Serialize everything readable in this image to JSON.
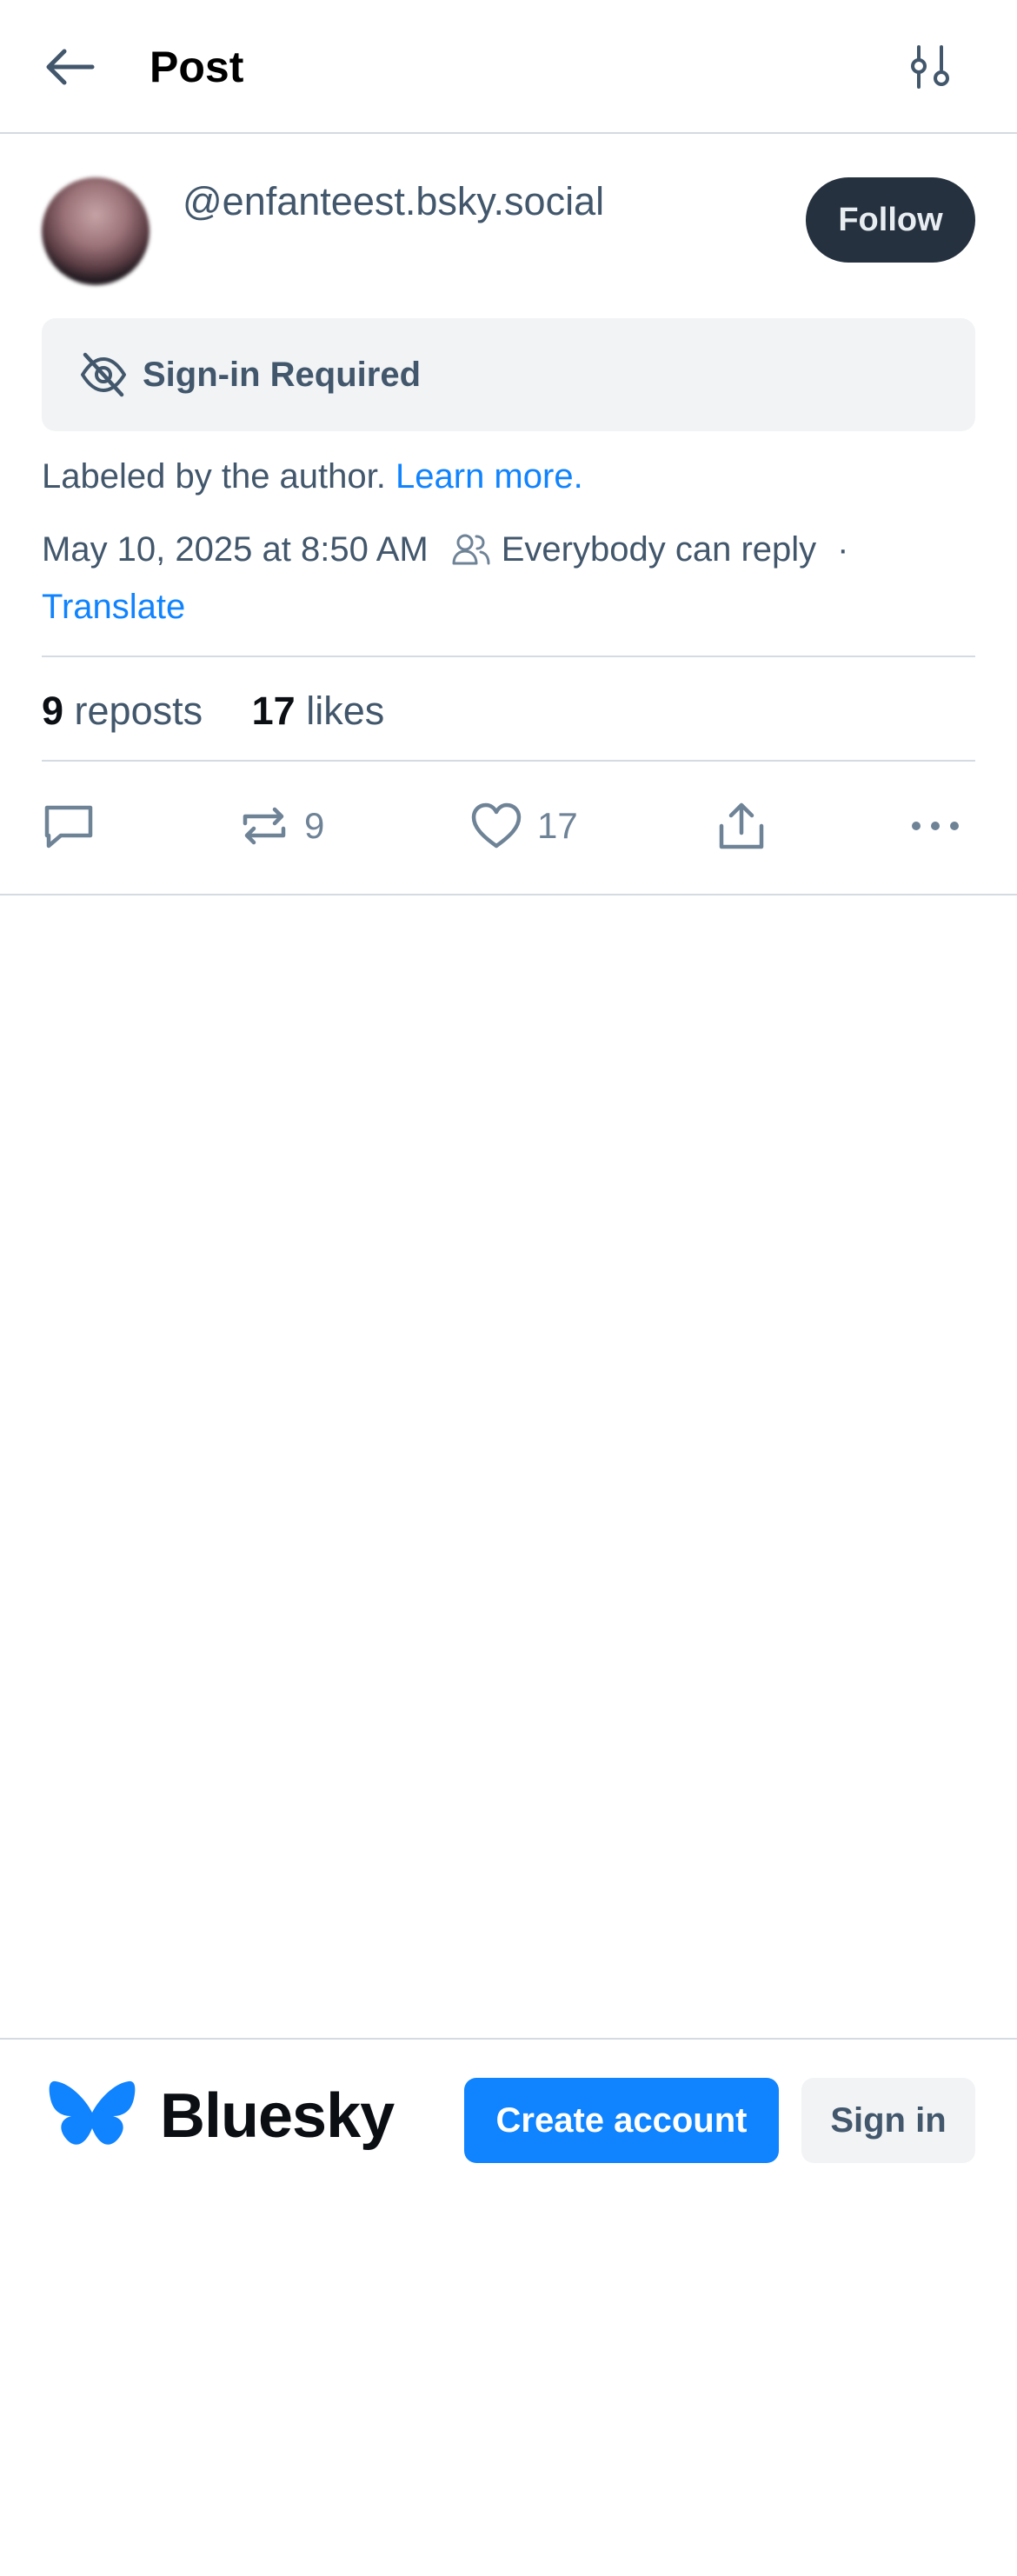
{
  "header": {
    "title": "Post",
    "back_icon": "arrow-left-icon",
    "filter_icon": "sliders-icon"
  },
  "author": {
    "handle": "@enfanteest.bsky.social",
    "follow_label": "Follow"
  },
  "notice": {
    "text": "Sign-in Required",
    "icon": "eye-slash-icon"
  },
  "label_line": {
    "text": "Labeled by the author.",
    "link": "Learn more."
  },
  "meta": {
    "timestamp": "May 10, 2025 at 8:50 AM",
    "reply_setting": "Everybody can reply",
    "separator": "·",
    "translate": "Translate"
  },
  "stats": {
    "reposts_count": "9",
    "reposts_label": "reposts",
    "likes_count": "17",
    "likes_label": "likes"
  },
  "actions": {
    "reply_count": "",
    "repost_count": "9",
    "like_count": "17"
  },
  "bottom_bar": {
    "brand": "Bluesky",
    "create_account": "Create account",
    "sign_in": "Sign in"
  },
  "colors": {
    "accent": "#1083fe",
    "follow_bg": "#25313f",
    "muted_text": "#42576c",
    "divider": "#d4dbe2"
  }
}
